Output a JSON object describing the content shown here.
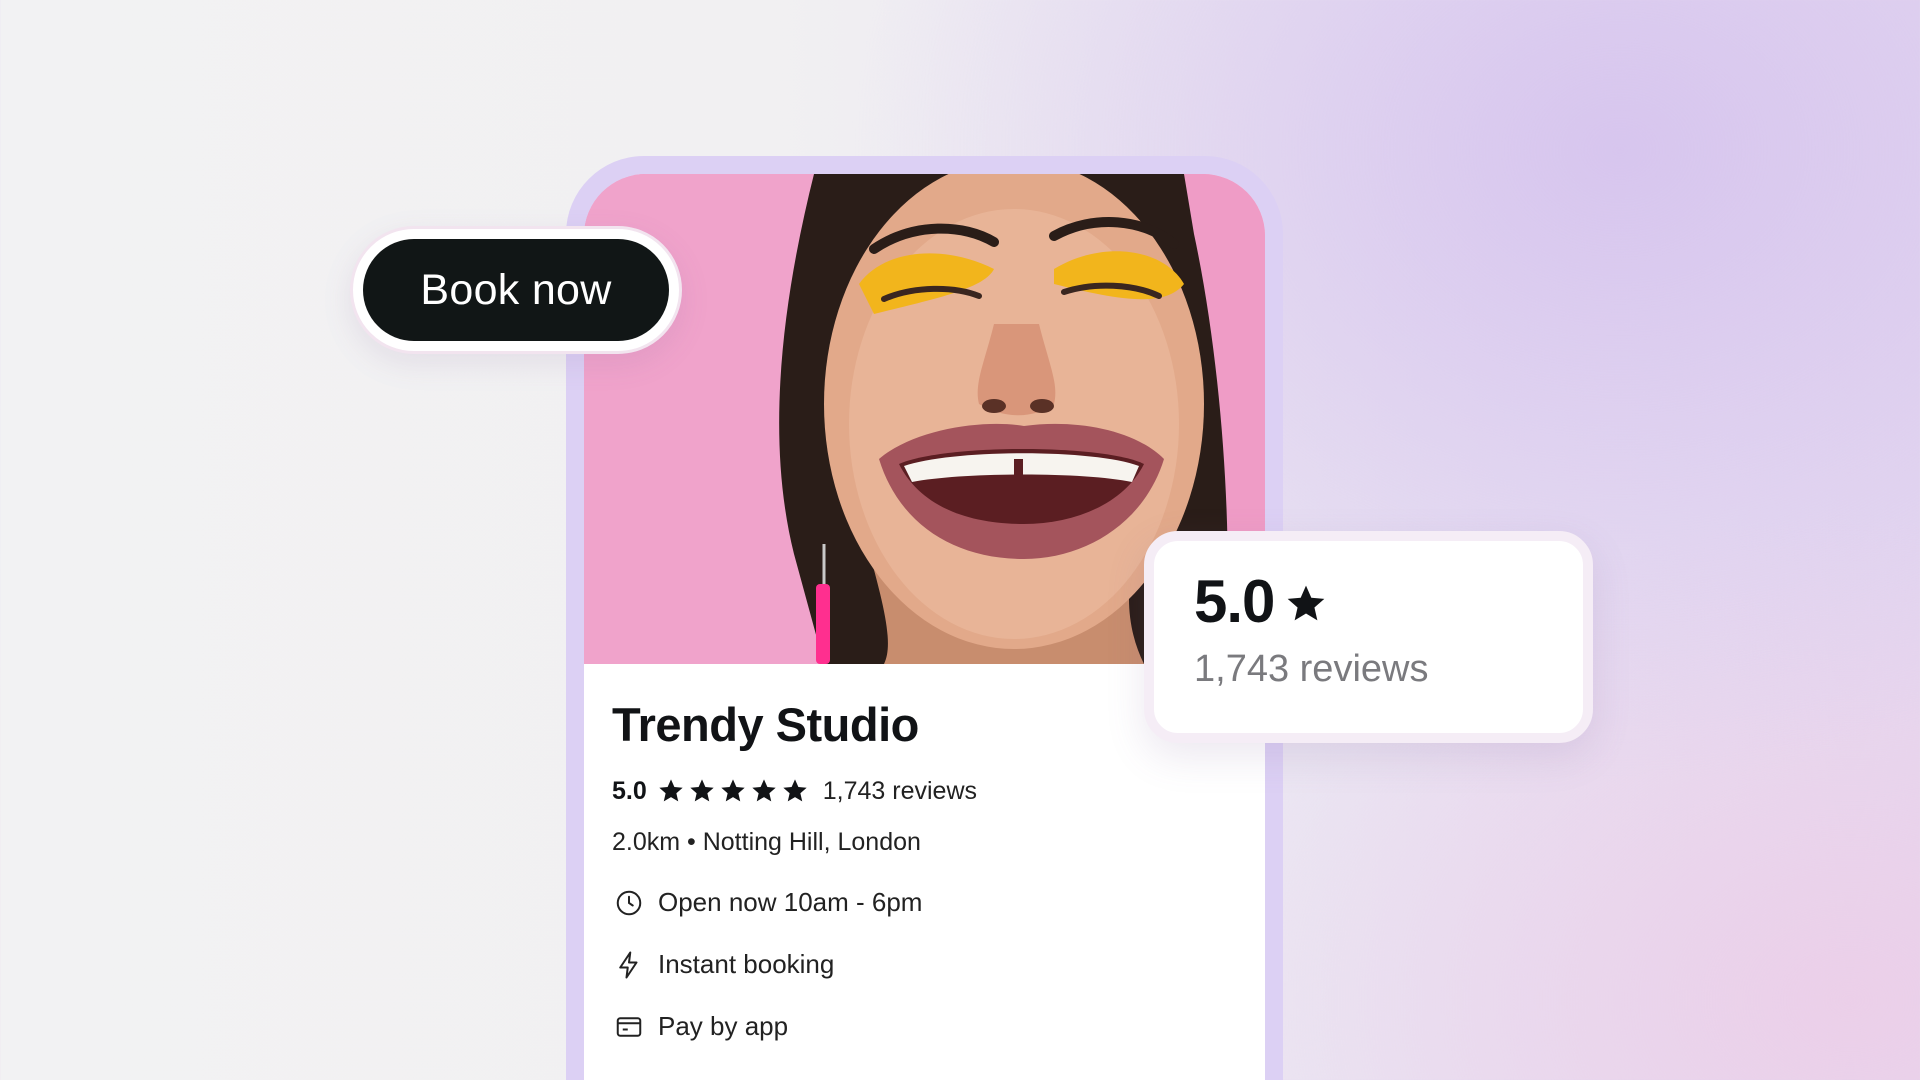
{
  "book_button": {
    "label": "Book now"
  },
  "business": {
    "name": "Trendy Studio",
    "rating": "5.0",
    "stars": 5,
    "review_count": "1,743 reviews",
    "location": "2.0km • Notting Hill, London",
    "features": [
      {
        "icon": "clock-icon",
        "label": "Open now 10am - 6pm"
      },
      {
        "icon": "lightning-icon",
        "label": "Instant booking"
      },
      {
        "icon": "card-icon",
        "label": "Pay by app"
      }
    ]
  },
  "rating_card": {
    "score": "5.0",
    "reviews": "1,743 reviews"
  },
  "colors": {
    "button_bg": "#111616",
    "frame": "#dcd0f4",
    "photo_bg": "#ef9cc6",
    "eyeshadow": "#f2b51c"
  }
}
